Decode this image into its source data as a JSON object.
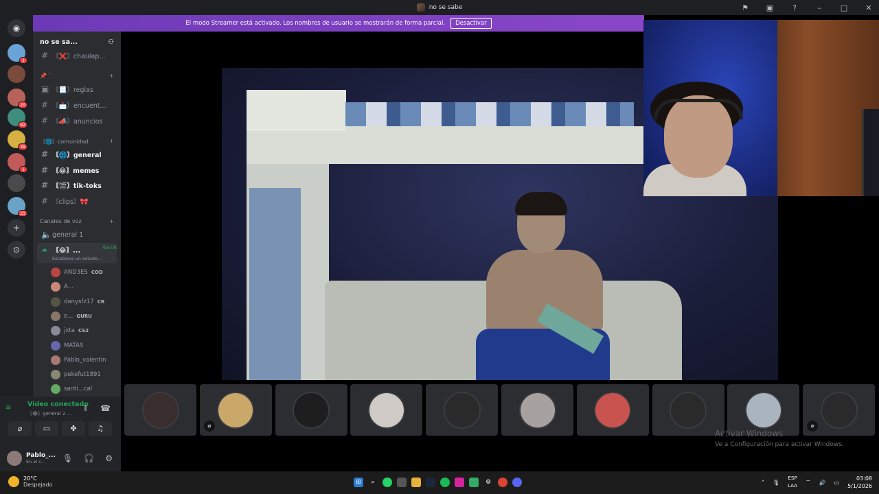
{
  "window": {
    "title": "no se sabe"
  },
  "banner": {
    "text": "El modo Streamer está activado. Los nombres de usuario se mostrarán de forma parcial.",
    "button": "Desactivar"
  },
  "guilds": [
    {
      "badge": "1",
      "color": "#6aa3d6"
    },
    {
      "badge": "",
      "color": "#7a4a3a"
    },
    {
      "badge": "20",
      "color": "#b8635a"
    },
    {
      "badge": "62",
      "color": "#3e8e7e"
    },
    {
      "badge": "39",
      "color": "#d6b040"
    },
    {
      "badge": "1",
      "color": "#c25a5a"
    },
    {
      "badge": "",
      "color": "#4a4a4a"
    },
    {
      "badge": "21",
      "color": "#6aa3c6"
    }
  ],
  "server": {
    "name": "no se sa..."
  },
  "channels": {
    "top_partial": "〘❌〙chaulap...",
    "items": [
      {
        "label": "〘📃〙reglas"
      },
      {
        "label": "〘📩〙encuent..."
      },
      {
        "label": "〘📣〙anuncios"
      }
    ],
    "cat_comunidad": "〘🌐〙comunidad",
    "comunidad": [
      {
        "label": "〘🌐〙general"
      },
      {
        "label": "〘😂〙memes"
      },
      {
        "label": "〘🎬〙tik-toks"
      },
      {
        "label": "〘clips〙🎀"
      }
    ],
    "cat_voz": "Canales de voz",
    "voice_general": "general 1",
    "voice_active": {
      "label": "〘😂〙...",
      "time": "63:06",
      "status": "Establece un estado..."
    },
    "voice_users": [
      {
        "name": "AND3ES",
        "tag": "COD",
        "color": "#b44"
      },
      {
        "name": "A...",
        "tag": "",
        "color": "#c87"
      },
      {
        "name": "danysfz17",
        "tag": "CR",
        "color": "#554"
      },
      {
        "name": "e...",
        "tag": "GURU",
        "color": "#876"
      },
      {
        "name": "jxta",
        "tag": "CS2",
        "color": "#889"
      },
      {
        "name": "MATAS",
        "tag": "",
        "color": "#66a"
      },
      {
        "name": "Pablo_valentin",
        "tag": "",
        "color": "#a77"
      },
      {
        "name": "pekefut1891",
        "tag": "",
        "color": "#887"
      },
      {
        "name": "santi...cal",
        "tag": "",
        "color": "#6a6"
      }
    ]
  },
  "voice_panel": {
    "status": "Video conectado",
    "sub": "〘😂〙general 2 ..."
  },
  "user": {
    "name": "Pablo_...",
    "status": "En el c..."
  },
  "tiles": [
    {
      "color": "#3a2d2e",
      "muted": false
    },
    {
      "color": "#c9a86a",
      "muted": true
    },
    {
      "color": "#1e1e1e",
      "muted": false
    },
    {
      "color": "#cfcac6",
      "muted": false
    },
    {
      "color": "#2a2a2a",
      "muted": false
    },
    {
      "color": "#a7a2a0",
      "muted": false
    },
    {
      "color": "#c9534f",
      "muted": false
    },
    {
      "color": "#2a2a2a",
      "muted": false
    },
    {
      "color": "#aab4bf",
      "muted": false
    },
    {
      "color": "#2a2a2a",
      "muted": true
    }
  ],
  "watermark": {
    "title": "Activar Windows",
    "sub": "Ve a Configuración para activar Windows."
  },
  "taskbar": {
    "temp": "20°C",
    "weather": "Despejado",
    "lang1": "ESP",
    "lang2": "LAA",
    "time": "03:08",
    "date": "5/1/2026"
  }
}
